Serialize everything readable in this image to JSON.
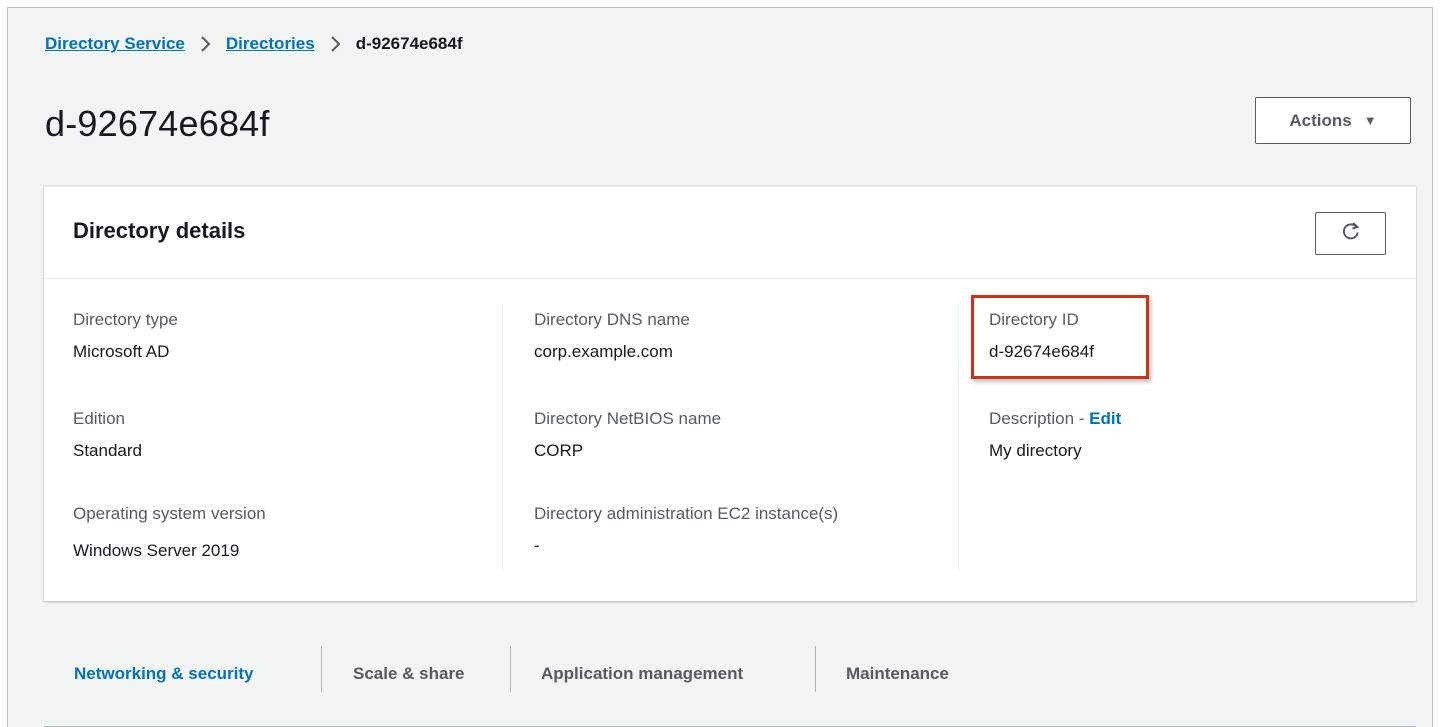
{
  "breadcrumb": {
    "items": [
      "Directory Service",
      "Directories"
    ],
    "current": "d-92674e684f"
  },
  "page": {
    "title": "d-92674e684f",
    "actions_label": "Actions"
  },
  "details": {
    "title": "Directory details",
    "fields": {
      "directory_type": {
        "label": "Directory type",
        "value": "Microsoft AD"
      },
      "edition": {
        "label": "Edition",
        "value": "Standard"
      },
      "os_version": {
        "label": "Operating system version",
        "value": "Windows Server 2019"
      },
      "dns_name": {
        "label": "Directory DNS name",
        "value": "corp.example.com"
      },
      "netbios_name": {
        "label": "Directory NetBIOS name",
        "value": "CORP"
      },
      "ec2_instances": {
        "label": "Directory administration EC2 instance(s)",
        "value": "-"
      },
      "directory_id": {
        "label": "Directory ID",
        "value": "d-92674e684f"
      },
      "description": {
        "label": "Description - ",
        "edit_label": "Edit",
        "value": "My directory"
      }
    }
  },
  "tabs": [
    "Networking & security",
    "Scale & share",
    "Application management",
    "Maintenance"
  ],
  "colors": {
    "link": "#0073bb",
    "highlight": "#d13212",
    "background": "#f2f3f3"
  },
  "icons": {
    "refresh": "refresh-icon",
    "breadcrumb_separator": "chevron-right-icon",
    "actions_caret": "caret-down-icon"
  }
}
